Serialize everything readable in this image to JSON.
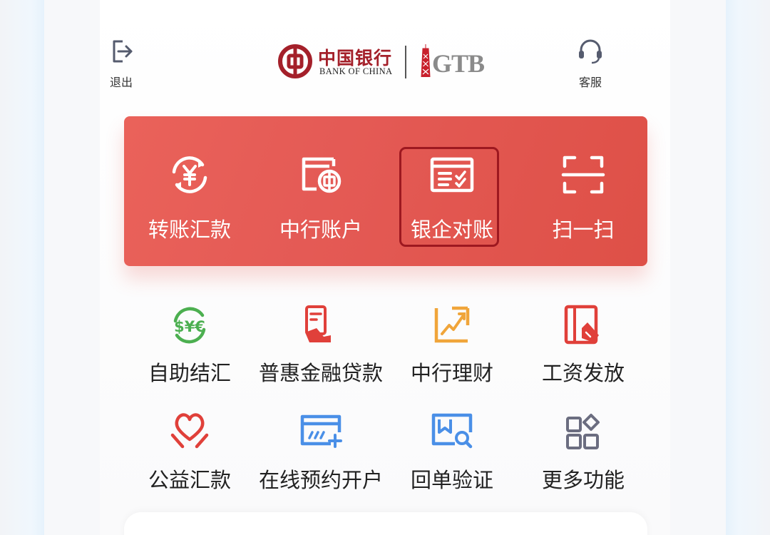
{
  "header": {
    "logout_label": "退出",
    "service_label": "客服",
    "logo_cn": "中国银行",
    "logo_en": "BANK OF CHINA",
    "logo_gtb": "GTB"
  },
  "quick_actions": [
    {
      "label": "转账汇款",
      "icon": "yen-exchange-icon"
    },
    {
      "label": "中行账户",
      "icon": "bank-card-icon"
    },
    {
      "label": "银企对账",
      "icon": "reconciliation-icon",
      "selected": true
    },
    {
      "label": "扫一扫",
      "icon": "scan-icon"
    }
  ],
  "services": [
    {
      "label": "自助结汇",
      "icon": "currency-exchange-icon",
      "color": "#4caf50"
    },
    {
      "label": "普惠金融贷款",
      "icon": "loan-document-icon",
      "color": "#e0403a"
    },
    {
      "label": "中行理财",
      "icon": "chart-growth-icon",
      "color": "#f0a53a"
    },
    {
      "label": "工资发放",
      "icon": "salary-book-icon",
      "color": "#e0403a"
    },
    {
      "label": "公益汇款",
      "icon": "heart-hand-icon",
      "color": "#e0403a"
    },
    {
      "label": "在线预约开户",
      "icon": "card-add-icon",
      "color": "#4a8fe7"
    },
    {
      "label": "回单验证",
      "icon": "image-search-icon",
      "color": "#4a8fe7"
    },
    {
      "label": "更多功能",
      "icon": "more-grid-icon",
      "color": "#6b6d80"
    }
  ],
  "colors": {
    "brand_red": "#e45a55",
    "selection_border": "#9d1820"
  }
}
